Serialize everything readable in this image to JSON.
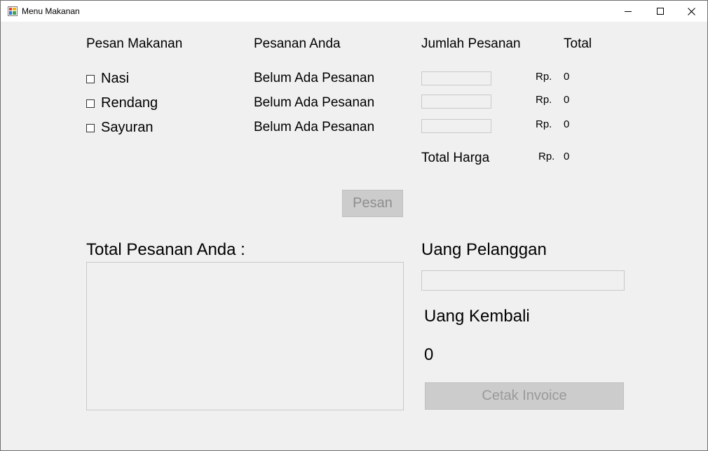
{
  "window": {
    "title": "Menu Makanan"
  },
  "headers": {
    "pesan_makanan": "Pesan Makanan",
    "pesanan_anda": "Pesanan Anda",
    "jumlah_pesanan": "Jumlah Pesanan",
    "total": "Total"
  },
  "items": [
    {
      "name": "Nasi",
      "status": "Belum Ada Pesanan",
      "quantity": "",
      "currency": "Rp.",
      "total": "0"
    },
    {
      "name": "Rendang",
      "status": "Belum Ada Pesanan",
      "quantity": "",
      "currency": "Rp.",
      "total": "0"
    },
    {
      "name": "Sayuran",
      "status": "Belum Ada Pesanan",
      "quantity": "",
      "currency": "Rp.",
      "total": "0"
    }
  ],
  "total_harga": {
    "label": "Total Harga",
    "currency": "Rp.",
    "value": "0"
  },
  "pesan_button": "Pesan",
  "total_pesanan": {
    "label": "Total Pesanan Anda :",
    "text": ""
  },
  "uang_pelanggan": {
    "label": "Uang Pelanggan",
    "value": ""
  },
  "uang_kembali": {
    "label": "Uang Kembali",
    "value": "0"
  },
  "cetak_button": "Cetak Invoice"
}
